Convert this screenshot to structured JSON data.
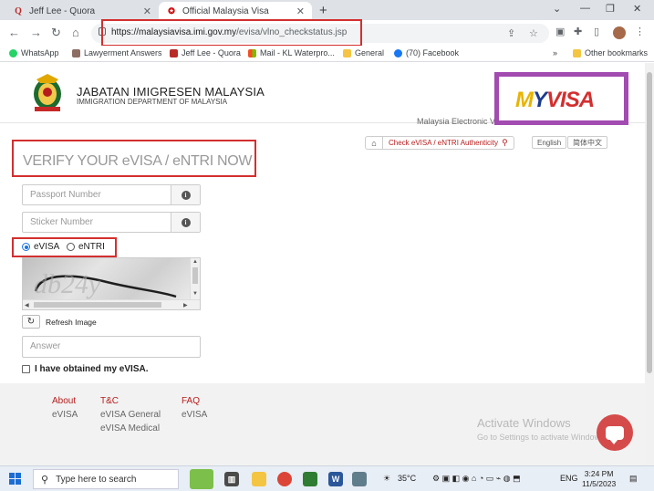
{
  "browser": {
    "tabs": [
      {
        "title": "Jeff Lee - Quora",
        "favicon": "quora-icon",
        "active": false
      },
      {
        "title": "Official Malaysia Visa",
        "favicon": "gov-icon",
        "active": true
      }
    ],
    "url_host": "https://malaysiavisa.imi.gov.my",
    "url_path": "/evisa/vlno_checkstatus.jsp",
    "bookmarks": [
      "WhatsApp",
      "Lawyerment Answers",
      "Jeff Lee - Quora",
      "Mail - KL Waterpro...",
      "General",
      "(70) Facebook"
    ],
    "other_bookmarks": "Other bookmarks",
    "highlight_color": "#d32f2f"
  },
  "header": {
    "dept_title": "JABATAN IMIGRESEN MALAYSIA",
    "dept_subtitle": "IMMIGRATION DEPARTMENT OF MALAYSIA",
    "logo_m": "M",
    "logo_y": "Y",
    "logo_visa": "VISA",
    "logo_border_color": "#a24bb0",
    "tagline": "Malaysia Electronic Visa Facilitation & Service"
  },
  "subnav": {
    "check_label": "Check eVISA / eNTRI Authenticity",
    "lang_en": "English",
    "lang_cn": "简体中文"
  },
  "form": {
    "title": "VERIFY YOUR eVISA / eNTRI NOW",
    "passport_placeholder": "Passport Number",
    "sticker_placeholder": "Sticker Number",
    "radio_evisa": "eVISA",
    "radio_entri": "eNTRI",
    "selected_type": "eVISA",
    "captcha_text": "db24y",
    "refresh_label": "Refresh Image",
    "answer_placeholder": "Answer",
    "obtained_label": "I have obtained my eVISA."
  },
  "footer": {
    "about": {
      "heading": "About",
      "links": [
        "eVISA"
      ]
    },
    "tc": {
      "heading": "T&C",
      "links": [
        "eVISA General",
        "eVISA Medical"
      ]
    },
    "faq": {
      "heading": "FAQ",
      "links": [
        "eVISA"
      ]
    }
  },
  "watermark": {
    "line1": "Activate Windows",
    "line2": "Go to Settings to activate Windows."
  },
  "taskbar": {
    "search_placeholder": "Type here to search",
    "temperature": "35°C",
    "language": "ENG",
    "time": "3:24 PM",
    "date": "11/5/2023"
  }
}
